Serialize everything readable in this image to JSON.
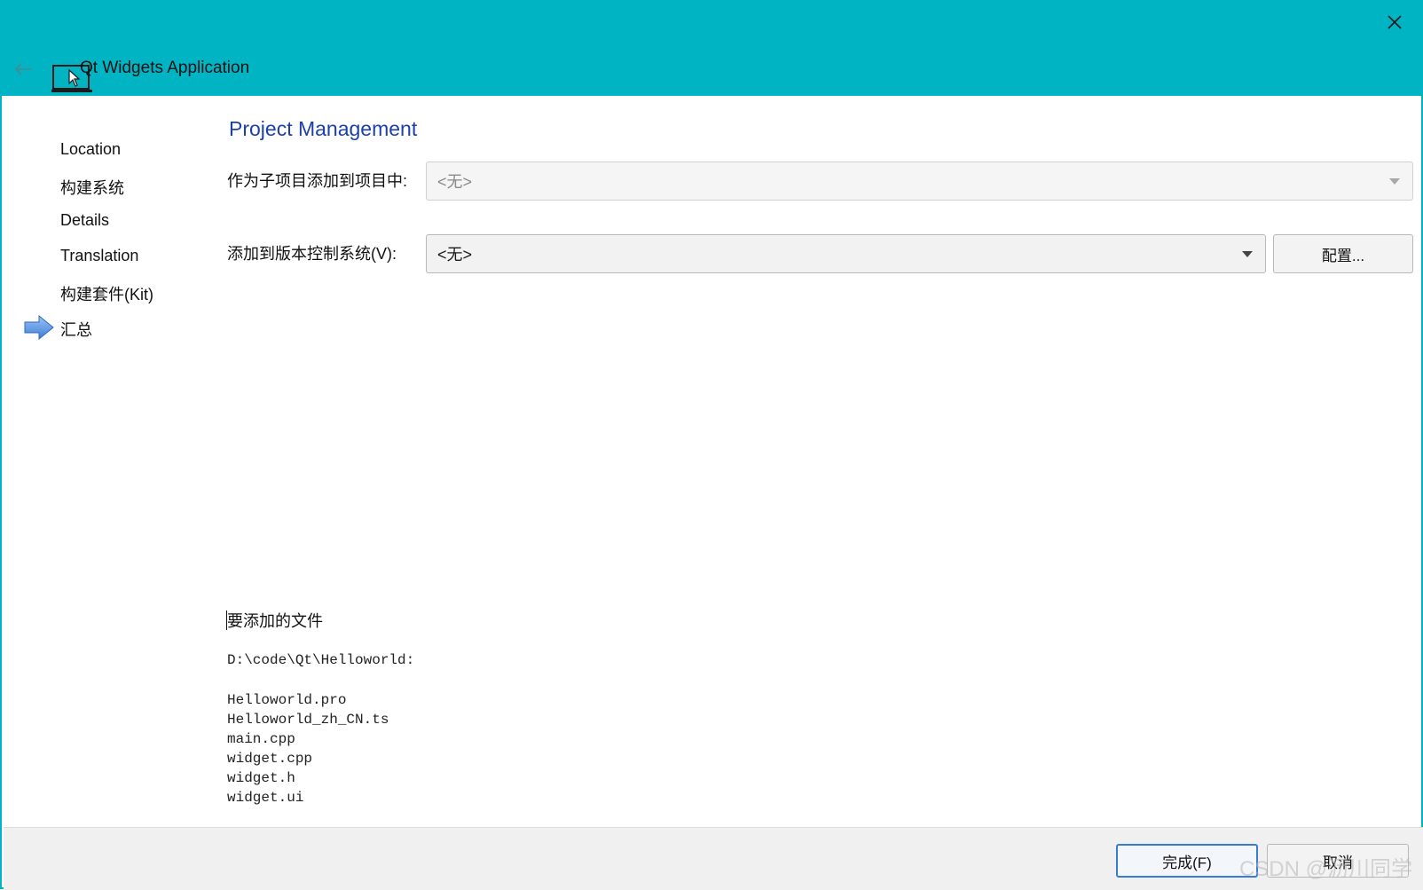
{
  "window": {
    "title": "Qt Widgets Application",
    "accent_color": "#00b4c4",
    "close_icon": "close-icon",
    "back_icon": "back-arrow-icon",
    "app_icon": "monitor-cursor-icon"
  },
  "sidebar": {
    "steps": [
      {
        "label": "Location"
      },
      {
        "label": "构建系统"
      },
      {
        "label": "Details"
      },
      {
        "label": "Translation"
      },
      {
        "label": "构建套件(Kit)"
      },
      {
        "label": "汇总",
        "current": true
      }
    ],
    "current_marker_icon": "arrow-right-icon"
  },
  "main": {
    "section_title": "Project Management",
    "title_color": "#1b3fae",
    "subproject": {
      "label": "作为子项目添加到项目中:",
      "value": "<无>",
      "enabled": false
    },
    "version_control": {
      "label": "添加到版本控制系统(V):",
      "value": "<无>",
      "configure_label": "配置..."
    },
    "files": {
      "heading": "要添加的文件",
      "directory": "D:\\code\\Qt\\Helloworld:",
      "list": [
        "Helloworld.pro",
        "Helloworld_zh_CN.ts",
        "main.cpp",
        "widget.cpp",
        "widget.h",
        "widget.ui"
      ]
    }
  },
  "footer": {
    "finish_label": "完成(F)",
    "cancel_label": "取消"
  },
  "watermark": "CSDN @沥川同学"
}
